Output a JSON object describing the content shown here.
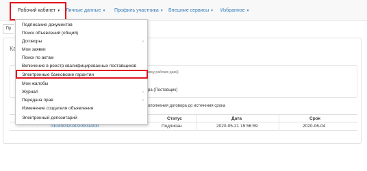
{
  "navbar": {
    "items": [
      {
        "label": "Рабочий кабинет"
      },
      {
        "label": "Личные данные"
      },
      {
        "label": "Профиль участника"
      },
      {
        "label": "Внешние сервисы"
      },
      {
        "label": "Избранное"
      }
    ]
  },
  "page": {
    "button_partial": "Пр",
    "panel_title_partial": "Ка",
    "note_partial": "иску рабочих дней)",
    "party_partial": "ра (Поставщик)",
    "deadline_text_partial": "ополнения договора до истечения срока",
    "table": {
      "headers": [
        "Статус",
        "Дата",
        "Срок"
      ],
      "row": {
        "number": "01040002030200014/00",
        "status": "Подписан",
        "date": "2020-05-21 15:56:59",
        "term": "2020-06-04"
      }
    }
  },
  "dropdown": {
    "items": [
      {
        "label": "Подписание документов",
        "submenu": false
      },
      {
        "label": "Поиск объявлений (общий)",
        "submenu": false
      },
      {
        "label": "Договоры",
        "submenu": true
      },
      {
        "label": "Мои заявки",
        "submenu": false
      },
      {
        "label": "Поиск по актам",
        "submenu": false
      },
      {
        "label": "Включение в реестр квалифицированных поставщиков",
        "submenu": false
      },
      {
        "label": "Электронные банковские гарантии",
        "submenu": false,
        "highlighted": true
      },
      {
        "label": "Мои жалобы",
        "submenu": false
      },
      {
        "label": "Журнал",
        "submenu": true
      },
      {
        "label": "Передача прав",
        "submenu": true
      },
      {
        "label": "Изменение создателя объявления",
        "submenu": false
      },
      {
        "label": "Электронный депозитарий",
        "submenu": false
      }
    ],
    "submenu_glyph": "›"
  },
  "colors": {
    "link": "#337ab7",
    "highlight": "#e0141e",
    "navbar_bg": "#f8f8f8"
  },
  "icons": {
    "caret": "caret-down-icon",
    "submenu": "chevron-right-icon"
  }
}
